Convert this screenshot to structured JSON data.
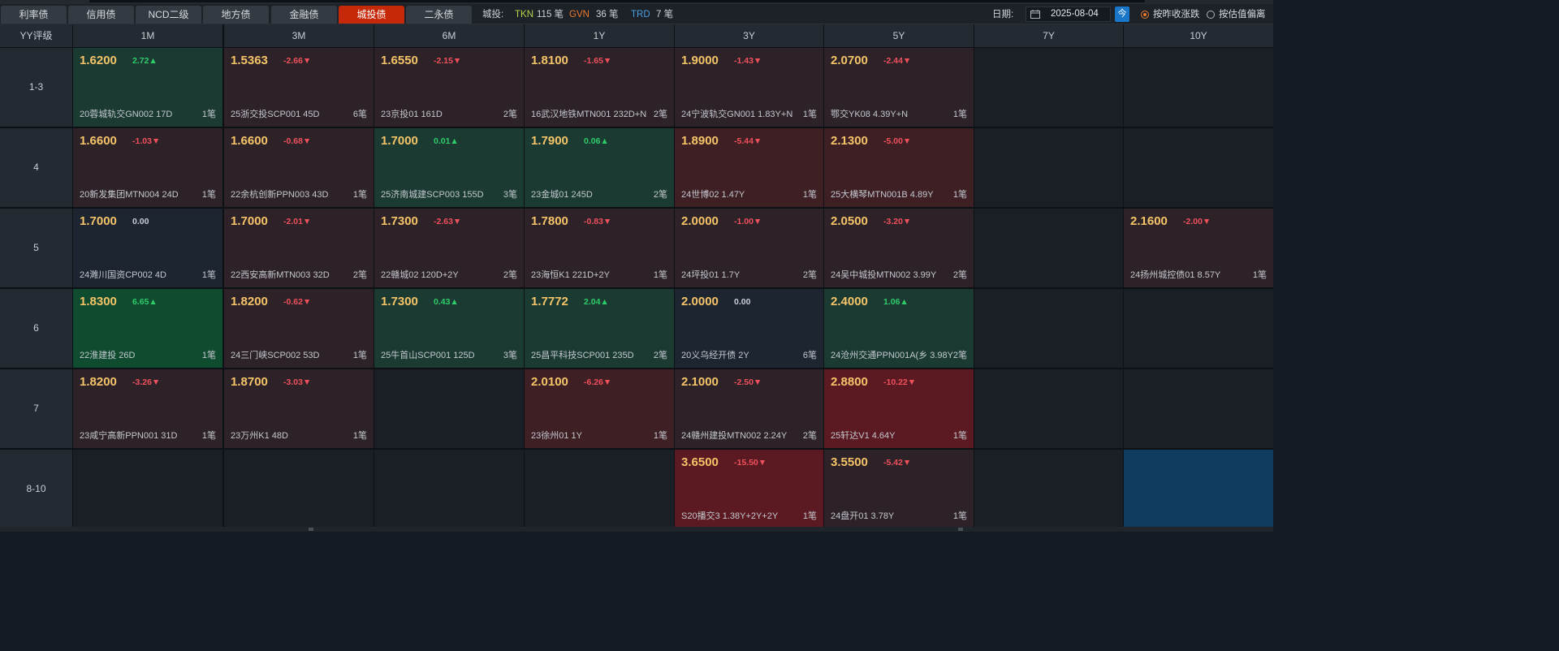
{
  "tabs": [
    {
      "label": "利率债",
      "active": false
    },
    {
      "label": "信用债",
      "active": false
    },
    {
      "label": "NCD二级",
      "active": false
    },
    {
      "label": "地方债",
      "active": false
    },
    {
      "label": "金融债",
      "active": false
    },
    {
      "label": "城投债",
      "active": true
    },
    {
      "label": "二永债",
      "active": false
    }
  ],
  "counts": {
    "label": "城投:",
    "tkn_label": "TKN",
    "tkn_value": "115 笔",
    "gvn_label": "GVN",
    "gvn_value": "36 笔",
    "trd_label": "TRD",
    "trd_value": "7 笔"
  },
  "date": {
    "label": "日期:",
    "value": "2025-08-04",
    "today_button": "今"
  },
  "modes": [
    {
      "label": "按昨收涨跌",
      "selected": true
    },
    {
      "label": "按估值偏离",
      "selected": false
    }
  ],
  "grid": {
    "corner": "YY评级",
    "columns": [
      "1M",
      "3M",
      "6M",
      "1Y",
      "3Y",
      "5Y",
      "7Y",
      "10Y"
    ],
    "rows": [
      {
        "label": "1-3",
        "cells": [
          {
            "price": "1.6200",
            "change": "2.72▲",
            "dir": "pos",
            "bond": "20蓉城轨交GN002 17D",
            "count": "1笔",
            "tone": "up"
          },
          {
            "price": "1.5363",
            "change": "-2.66▼",
            "dir": "neg",
            "bond": "25浙交投SCP001 45D",
            "count": "6笔",
            "tone": "down"
          },
          {
            "price": "1.6550",
            "change": "-2.15▼",
            "dir": "neg",
            "bond": "23京投01 161D",
            "count": "2笔",
            "tone": "down"
          },
          {
            "price": "1.8100",
            "change": "-1.65▼",
            "dir": "neg",
            "bond": "16武汉地铁MTN001 232D+N",
            "count": "2笔",
            "tone": "down"
          },
          {
            "price": "1.9000",
            "change": "-1.43▼",
            "dir": "neg",
            "bond": "24宁波轨交GN001 1.83Y+N",
            "count": "1笔",
            "tone": "down"
          },
          {
            "price": "2.0700",
            "change": "-2.44▼",
            "dir": "neg",
            "bond": "鄂交YK08 4.39Y+N",
            "count": "1笔",
            "tone": "down"
          },
          null,
          null
        ]
      },
      {
        "label": "4",
        "cells": [
          {
            "price": "1.6600",
            "change": "-1.03▼",
            "dir": "neg",
            "bond": "20新发集团MTN004 24D",
            "count": "1笔",
            "tone": "down"
          },
          {
            "price": "1.6600",
            "change": "-0.68▼",
            "dir": "neg",
            "bond": "22余杭创新PPN003 43D",
            "count": "1笔",
            "tone": "down"
          },
          {
            "price": "1.7000",
            "change": "0.01▲",
            "dir": "pos",
            "bond": "25济南城建SCP003 155D",
            "count": "3笔",
            "tone": "up"
          },
          {
            "price": "1.7900",
            "change": "0.06▲",
            "dir": "pos",
            "bond": "23金城01 245D",
            "count": "2笔",
            "tone": "up"
          },
          {
            "price": "1.8900",
            "change": "-5.44▼",
            "dir": "neg",
            "bond": "24世博02 1.47Y",
            "count": "1笔",
            "tone": "down2"
          },
          {
            "price": "2.1300",
            "change": "-5.00▼",
            "dir": "neg",
            "bond": "25大横琴MTN001B 4.89Y",
            "count": "1笔",
            "tone": "down2"
          },
          null,
          null
        ]
      },
      {
        "label": "5",
        "cells": [
          {
            "price": "1.7000",
            "change": "0.00",
            "dir": "zero",
            "bond": "24濉川国资CP002 4D",
            "count": "1笔",
            "tone": "flat"
          },
          {
            "price": "1.7000",
            "change": "-2.01▼",
            "dir": "neg",
            "bond": "22西安高新MTN003 32D",
            "count": "2笔",
            "tone": "down"
          },
          {
            "price": "1.7300",
            "change": "-2.63▼",
            "dir": "neg",
            "bond": "22赣城02 120D+2Y",
            "count": "2笔",
            "tone": "down"
          },
          {
            "price": "1.7800",
            "change": "-0.83▼",
            "dir": "neg",
            "bond": "23海恒K1 221D+2Y",
            "count": "1笔",
            "tone": "down"
          },
          {
            "price": "2.0000",
            "change": "-1.00▼",
            "dir": "neg",
            "bond": "24坪投01 1.7Y",
            "count": "2笔",
            "tone": "down"
          },
          {
            "price": "2.0500",
            "change": "-3.20▼",
            "dir": "neg",
            "bond": "24吴中城投MTN002 3.99Y",
            "count": "2笔",
            "tone": "down"
          },
          null,
          {
            "price": "2.1600",
            "change": "-2.00▼",
            "dir": "neg",
            "bond": "24扬州城控债01 8.57Y",
            "count": "1笔",
            "tone": "down"
          }
        ]
      },
      {
        "label": "6",
        "cells": [
          {
            "price": "1.8300",
            "change": "6.65▲",
            "dir": "pos",
            "bond": "22淮建投 26D",
            "count": "1笔",
            "tone": "up2"
          },
          {
            "price": "1.8200",
            "change": "-0.62▼",
            "dir": "neg",
            "bond": "24三门峡SCP002 53D",
            "count": "1笔",
            "tone": "down"
          },
          {
            "price": "1.7300",
            "change": "0.43▲",
            "dir": "pos",
            "bond": "25牛首山SCP001 125D",
            "count": "3笔",
            "tone": "up"
          },
          {
            "price": "1.7772",
            "change": "2.04▲",
            "dir": "pos",
            "bond": "25昌平科技SCP001 235D",
            "count": "2笔",
            "tone": "up"
          },
          {
            "price": "2.0000",
            "change": "0.00",
            "dir": "zero",
            "bond": "20义乌经开债 2Y",
            "count": "6笔",
            "tone": "flat"
          },
          {
            "price": "2.4000",
            "change": "1.06▲",
            "dir": "pos",
            "bond": "24沧州交通PPN001A(乡 3.98Y",
            "count": "2笔",
            "tone": "up"
          },
          null,
          null
        ]
      },
      {
        "label": "7",
        "cells": [
          {
            "price": "1.8200",
            "change": "-3.26▼",
            "dir": "neg",
            "bond": "23咸宁高新PPN001 31D",
            "count": "1笔",
            "tone": "down"
          },
          {
            "price": "1.8700",
            "change": "-3.03▼",
            "dir": "neg",
            "bond": "23万州K1 48D",
            "count": "1笔",
            "tone": "down"
          },
          null,
          {
            "price": "2.0100",
            "change": "-6.26▼",
            "dir": "neg",
            "bond": "23徐州01 1Y",
            "count": "1笔",
            "tone": "down2"
          },
          {
            "price": "2.1000",
            "change": "-2.50▼",
            "dir": "neg",
            "bond": "24赣州建投MTN002 2.24Y",
            "count": "2笔",
            "tone": "down"
          },
          {
            "price": "2.8800",
            "change": "-10.22▼",
            "dir": "neg",
            "bond": "25轩达V1 4.64Y",
            "count": "1笔",
            "tone": "down3"
          },
          null,
          null
        ]
      },
      {
        "label": "8-10",
        "cells": [
          null,
          null,
          null,
          null,
          {
            "price": "3.6500",
            "change": "-15.50▼",
            "dir": "neg",
            "bond": "S20播交3 1.38Y+2Y+2Y",
            "count": "1笔",
            "tone": "down3"
          },
          {
            "price": "3.5500",
            "change": "-5.42▼",
            "dir": "neg",
            "bond": "24盘开01 3.78Y",
            "count": "1笔",
            "tone": "down"
          },
          null,
          {
            "empty_selected": true,
            "tone": "sel"
          }
        ]
      }
    ]
  },
  "colors": {
    "active_tab": "#c6290a",
    "price": "#f5c469",
    "negative": "#f0505c",
    "positive": "#2fcc6a",
    "today_button": "#1a76c9"
  }
}
